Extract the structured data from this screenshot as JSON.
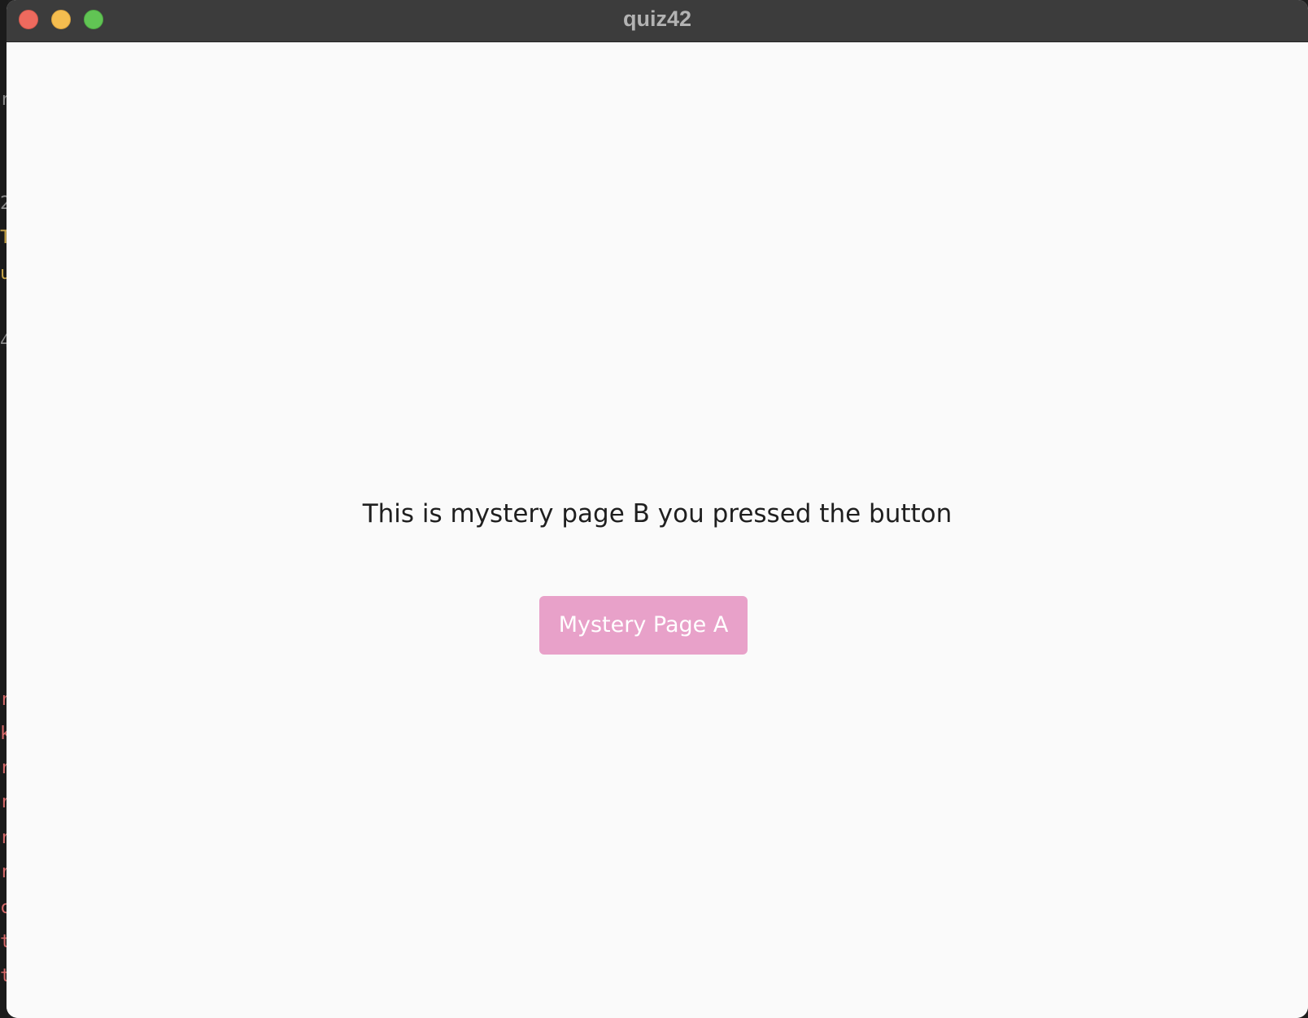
{
  "window": {
    "title": "quiz42",
    "controls": {
      "close": "close-window-button",
      "minimize": "minimize-window-button",
      "zoom": "zoom-window-button"
    }
  },
  "page": {
    "message": "This is mystery page B you pressed the button",
    "button_label": "Mystery Page A"
  },
  "colors": {
    "titlebar": "#3c3c3c",
    "content_background": "#fafafa",
    "button_background": "#e8a1c9",
    "button_text": "#ffffff",
    "message_text": "#1f1f1f",
    "close": "#ee6a5e",
    "minimize": "#f5bd4f",
    "zoom": "#61c454"
  }
}
